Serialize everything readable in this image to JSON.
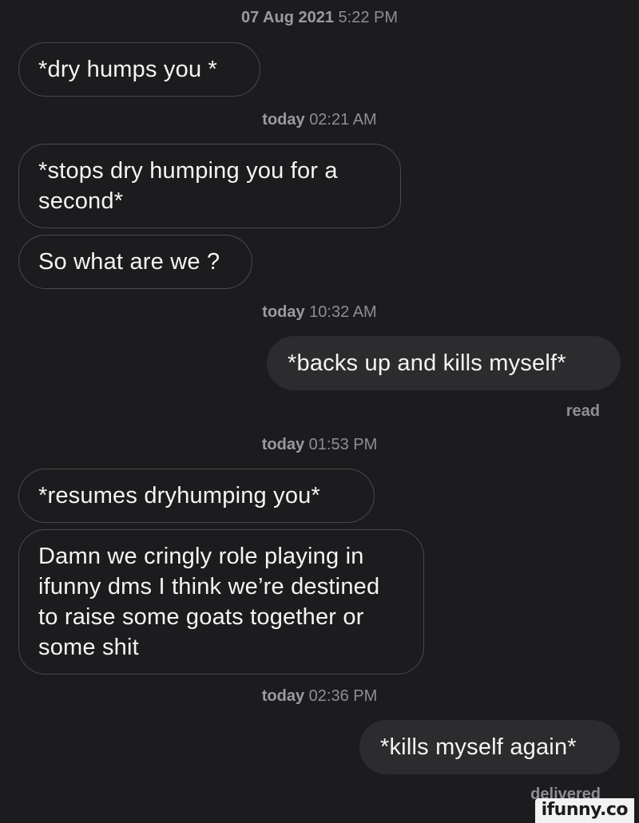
{
  "thread": {
    "stamp_1": {
      "day": "07 Aug 2021",
      "time": "5:22 PM"
    },
    "msg_1": "*dry humps you *",
    "stamp_2": {
      "day": "today",
      "time": "02:21 AM"
    },
    "msg_2": "*stops dry humping you for a second*",
    "msg_3": "So what are we ?",
    "stamp_3": {
      "day": "today",
      "time": "10:32 AM"
    },
    "msg_4": "*backs up and kills myself*",
    "status_1": "read",
    "stamp_4": {
      "day": "today",
      "time": "01:53 PM"
    },
    "msg_5": "*resumes dryhumping you*",
    "msg_6": "Damn we cringly role playing in ifunny dms I think we’re destined to raise some goats together or some shit",
    "stamp_5": {
      "day": "today",
      "time": "02:36 PM"
    },
    "msg_7": "*kills myself again*",
    "status_2": "delivered"
  },
  "watermark": "ifunny.co"
}
